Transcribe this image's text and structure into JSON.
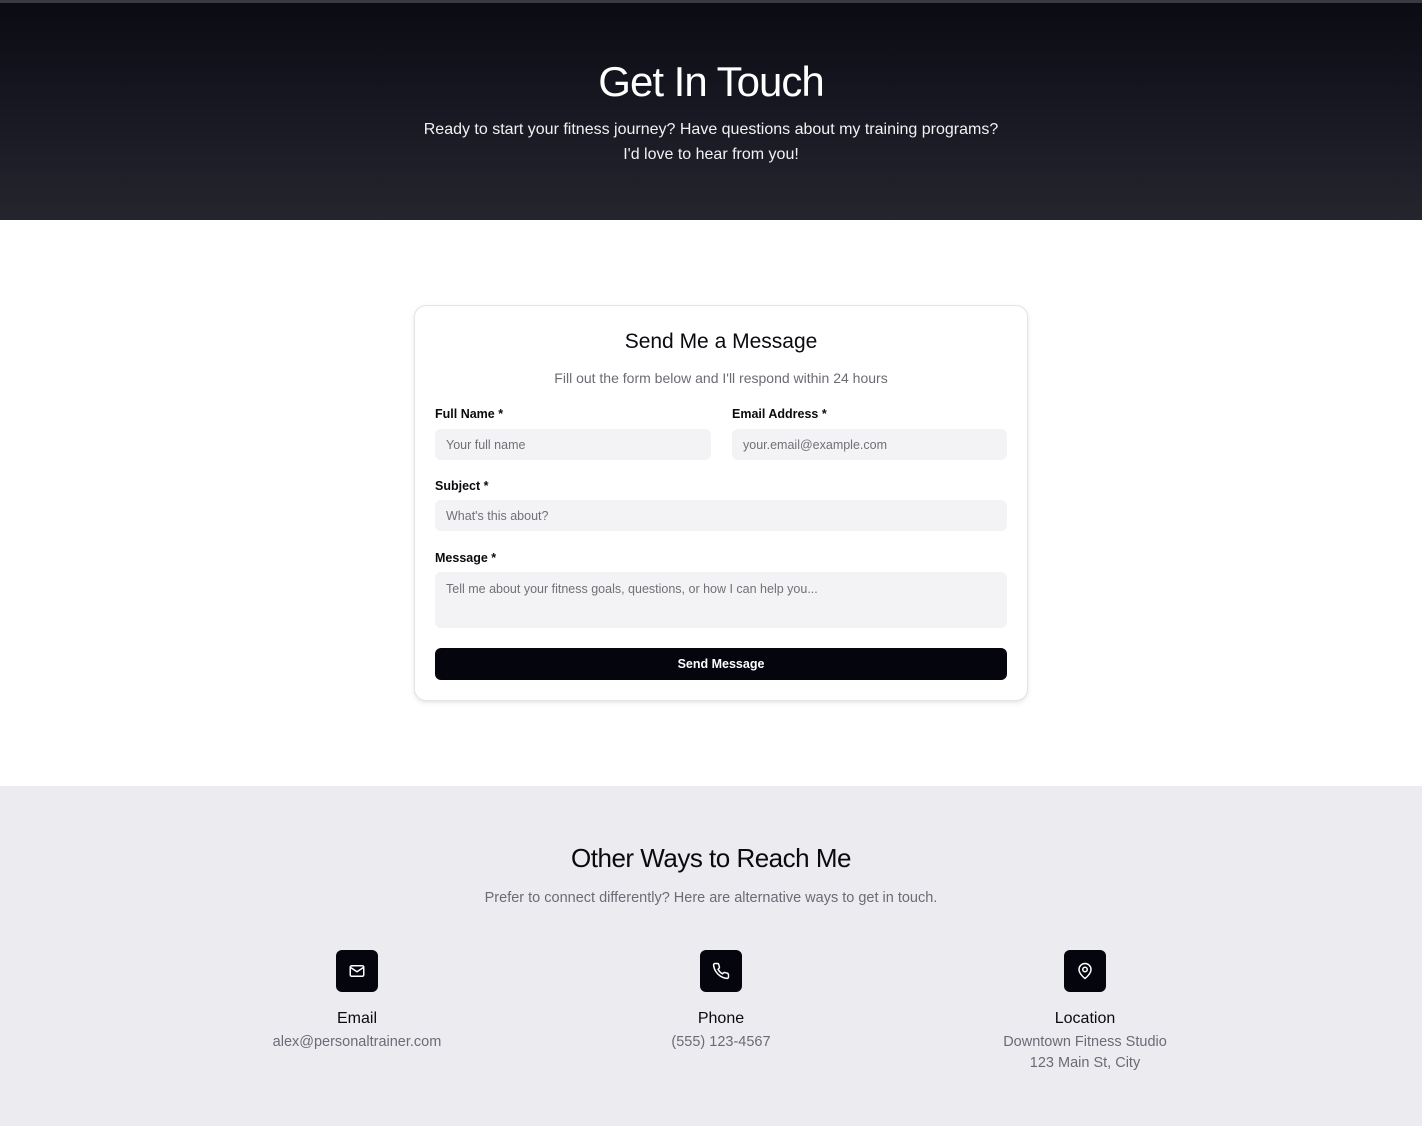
{
  "hero": {
    "title": "Get In Touch",
    "subtitle_line1": "Ready to start your fitness journey? Have questions about my training programs?",
    "subtitle_line2": "I'd love to hear from you!"
  },
  "form": {
    "title": "Send Me a Message",
    "description": "Fill out the form below and I'll respond within 24 hours",
    "full_name_label": "Full Name *",
    "full_name_placeholder": "Your full name",
    "email_label": "Email Address *",
    "email_placeholder": "your.email@example.com",
    "subject_label": "Subject *",
    "subject_placeholder": "What's this about?",
    "message_label": "Message *",
    "message_placeholder": "Tell me about your fitness goals, questions, or how I can help you...",
    "submit_label": "Send Message"
  },
  "other": {
    "title": "Other Ways to Reach Me",
    "description": "Prefer to connect differently? Here are alternative ways to get in touch.",
    "methods": [
      {
        "icon": "mail-icon",
        "title": "Email",
        "value_line1": "alex@personaltrainer.com",
        "value_line2": ""
      },
      {
        "icon": "phone-icon",
        "title": "Phone",
        "value_line1": "(555) 123-4567",
        "value_line2": ""
      },
      {
        "icon": "map-pin-icon",
        "title": "Location",
        "value_line1": "Downtown Fitness Studio",
        "value_line2": "123 Main St, City"
      }
    ]
  },
  "colors": {
    "accent": "#05050e",
    "muted_text": "#6b6b76",
    "section_bg": "#ececf0",
    "input_bg": "#f3f3f5"
  }
}
